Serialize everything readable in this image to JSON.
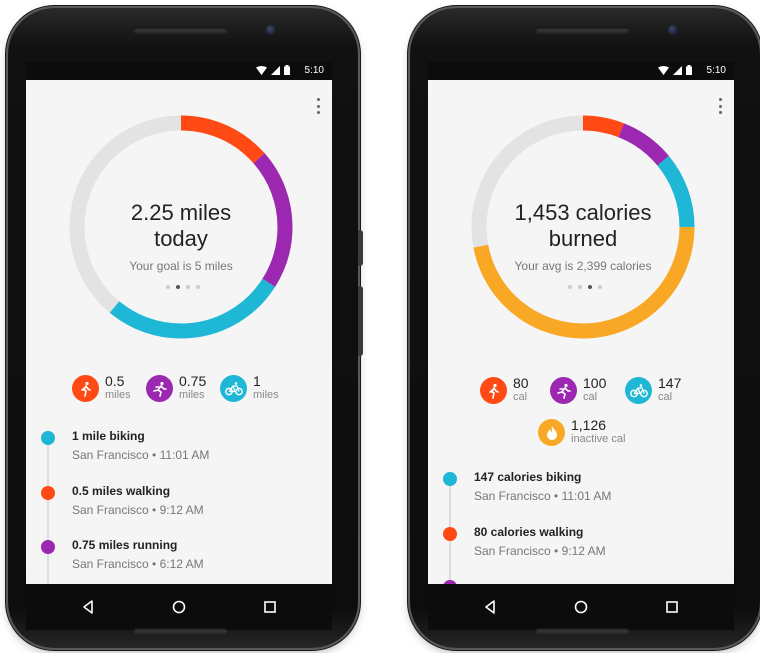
{
  "colors": {
    "running": "#FF5722",
    "walking_run": "#9C27B0",
    "biking": "#00BCD4",
    "inactive": "#F9A825",
    "track": "#e3e3e3"
  },
  "status_bar": {
    "time": "5:10"
  },
  "left_screen": {
    "ring": {
      "type": "progress-ring",
      "segments": [
        {
          "activity": "running",
          "color": "#FF4A15",
          "fraction": 0.135
        },
        {
          "activity": "walking",
          "color": "#9C27B0",
          "fraction": 0.205
        },
        {
          "activity": "biking",
          "color": "#1EB8D6",
          "fraction": 0.27
        }
      ],
      "remaining_fraction": 0.39
    },
    "headline_line1": "2.25 miles",
    "headline_line2": "today",
    "subtitle": "Your goal is 5 miles",
    "stats": [
      {
        "value": "0.5",
        "unit": "miles",
        "icon": "walking-icon",
        "color": "#FF4A15"
      },
      {
        "value": "0.75",
        "unit": "miles",
        "icon": "running-icon",
        "color": "#9C27B0"
      },
      {
        "value": "1",
        "unit": "miles",
        "icon": "bike-icon",
        "color": "#1EB8D6"
      }
    ],
    "timeline": [
      {
        "title": "1 mile biking",
        "meta": "San Francisco • 11:01 AM",
        "color": "#1EB8D6"
      },
      {
        "title": "0.5 miles walking",
        "meta": "San Francisco • 9:12 AM",
        "color": "#FF4A15"
      },
      {
        "title": "0.75 miles running",
        "meta": "San Francisco • 6:12 AM",
        "color": "#9C27B0"
      }
    ]
  },
  "right_screen": {
    "ring": {
      "type": "progress-ring",
      "segments": [
        {
          "activity": "walking",
          "color": "#FF4A15",
          "fraction": 0.06
        },
        {
          "activity": "running",
          "color": "#9C27B0",
          "fraction": 0.08
        },
        {
          "activity": "biking",
          "color": "#1EB8D6",
          "fraction": 0.11
        },
        {
          "activity": "inactive",
          "color": "#F9A825",
          "fraction": 0.47
        }
      ],
      "remaining_fraction": 0.28
    },
    "headline_line1": "1,453 calories",
    "headline_line2": "burned",
    "subtitle": "Your avg is 2,399 calories",
    "stats": [
      {
        "value": "80",
        "unit": "cal",
        "icon": "walking-icon",
        "color": "#FF4A15"
      },
      {
        "value": "100",
        "unit": "cal",
        "icon": "running-icon",
        "color": "#9C27B0"
      },
      {
        "value": "147",
        "unit": "cal",
        "icon": "bike-icon",
        "color": "#1EB8D6"
      },
      {
        "value": "1,126",
        "unit": "inactive cal",
        "icon": "flame-icon",
        "color": "#F9A825"
      }
    ],
    "timeline": [
      {
        "title": "147 calories biking",
        "meta": "San Francisco • 11:01 AM",
        "color": "#1EB8D6"
      },
      {
        "title": "80 calories walking",
        "meta": "San Francisco • 9:12 AM",
        "color": "#FF4A15"
      },
      {
        "title": "",
        "meta": "",
        "color": "#9C27B0"
      }
    ]
  }
}
